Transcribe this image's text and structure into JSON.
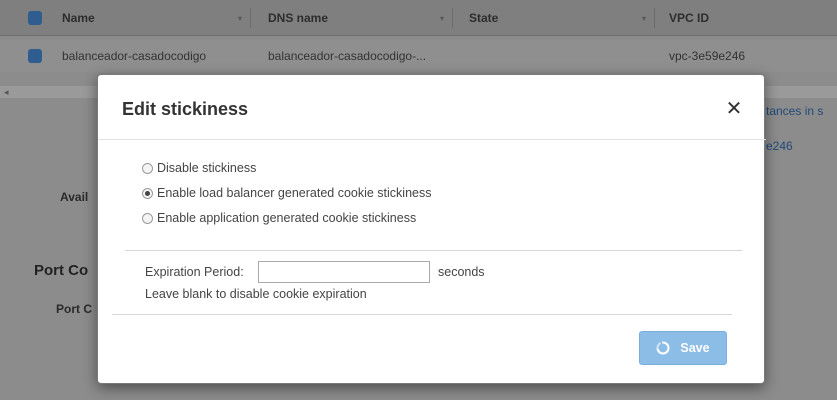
{
  "table": {
    "columns": [
      {
        "label": "Name"
      },
      {
        "label": "DNS name"
      },
      {
        "label": "State"
      },
      {
        "label": "VPC ID"
      }
    ],
    "rows": [
      {
        "name": "balanceador-casadocodigo",
        "dns": "balanceador-casadocodigo-...",
        "state": "",
        "vpc": "vpc-3e59e246"
      }
    ]
  },
  "background": {
    "link_fragment_1": "tances in s",
    "link_fragment_2": "e246",
    "label_avail": "Avail",
    "section_port": "Port Co",
    "label_port": "Port C"
  },
  "modal": {
    "title": "Edit stickiness",
    "close_glyph": "✕",
    "options": [
      {
        "label": "Disable stickiness",
        "selected": false
      },
      {
        "label": "Enable load balancer generated cookie stickiness",
        "selected": true
      },
      {
        "label": "Enable application generated cookie stickiness",
        "selected": false
      }
    ],
    "expiration": {
      "label": "Expiration Period:",
      "value": "",
      "placeholder": "",
      "unit": "seconds",
      "hint": "Leave blank to disable cookie expiration"
    },
    "save_label": "Save",
    "save_icon": "spinner-icon"
  },
  "colors": {
    "overlay": "#8c8c8c",
    "save_button": "#8cbde6",
    "checkbox": "#2f5d8f"
  }
}
